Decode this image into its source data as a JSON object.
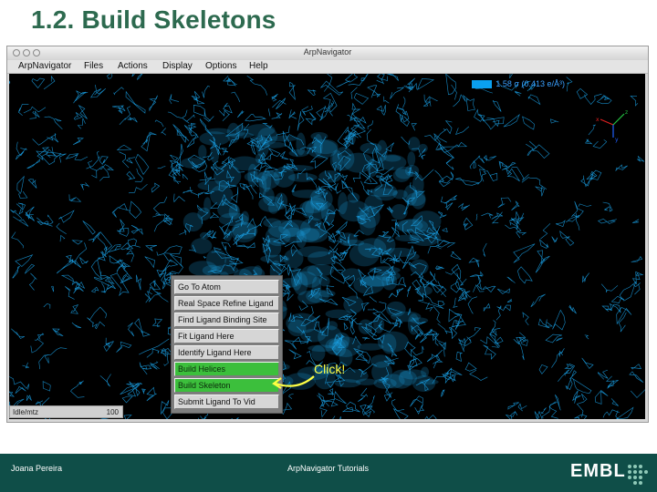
{
  "slide": {
    "title": "1.2. Build Skeletons"
  },
  "window": {
    "title": "ArpNavigator"
  },
  "menubar": {
    "items": [
      "ArpNavigator",
      "Files",
      "Actions",
      "Display",
      "Options",
      "Help"
    ]
  },
  "map_legend": {
    "text": "1.58 σ (0.413 e/Å³)",
    "swatch_color": "#0aa0f0"
  },
  "axes": {
    "x_label": "x",
    "y_label": "y",
    "z_label": "z"
  },
  "context_menu": {
    "items": [
      {
        "label": "Go To Atom",
        "highlighted": false
      },
      {
        "label": "Real Space Refine Ligand",
        "highlighted": false
      },
      {
        "label": "Find Ligand Binding Site",
        "highlighted": false
      },
      {
        "label": "Fit Ligand Here",
        "highlighted": false
      },
      {
        "label": "Identify Ligand Here",
        "highlighted": false
      },
      {
        "label": "Build Helices",
        "highlighted": true
      },
      {
        "label": "Build Skeleton",
        "highlighted": true
      },
      {
        "label": "Submit Ligand To Vid",
        "highlighted": false
      }
    ]
  },
  "statusbar": {
    "text": "Idle/mtz",
    "coords": "100"
  },
  "annotation": {
    "text": "Click!",
    "color": "#ffff44"
  },
  "footer": {
    "author": "Joana Pereira",
    "center": "ArpNavigator Tutorials",
    "logo": "EMBL"
  },
  "colors": {
    "title": "#2d6a4f",
    "density": "#1aa3ea",
    "footer_bg": "#0f4e48",
    "highlight": "#3cbf3c"
  }
}
